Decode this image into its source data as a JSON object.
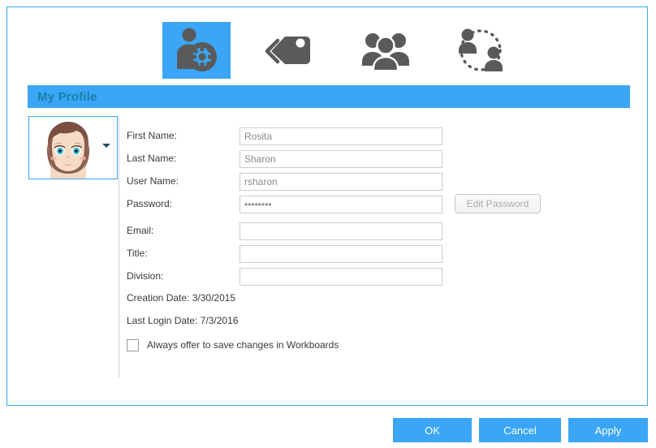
{
  "dialog": {
    "section_title": "My Profile",
    "accent_color": "#3aa6f5",
    "title_text_color": "#1a7fa9"
  },
  "toolbar": {
    "items": [
      {
        "name": "my-profile",
        "icon": "person-gear-icon",
        "selected": true
      },
      {
        "name": "tags",
        "icon": "tags-icon",
        "selected": false
      },
      {
        "name": "groups",
        "icon": "people-group-icon",
        "selected": false
      },
      {
        "name": "delegation",
        "icon": "people-sharing-icon",
        "selected": false
      }
    ]
  },
  "avatar": {
    "icon": "user-avatar-image",
    "dropdown_icon": "chevron-down-icon"
  },
  "form": {
    "fields": [
      {
        "label": "First Name:",
        "value": "Rosita",
        "placeholder": ""
      },
      {
        "label": "Last Name:",
        "value": "Sharon",
        "placeholder": ""
      },
      {
        "label": "User Name:",
        "value": "rsharon",
        "placeholder": ""
      },
      {
        "label": "Password:",
        "value": "••••••••",
        "placeholder": ""
      },
      {
        "label": "Email:",
        "value": "",
        "placeholder": ""
      },
      {
        "label": "Title:",
        "value": "",
        "placeholder": ""
      },
      {
        "label": "Division:",
        "value": "",
        "placeholder": ""
      }
    ],
    "edit_password_label": "Edit Password",
    "creation_date_line": "Creation Date: 3/30/2015",
    "last_login_line": "Last Login Date: 7/3/2016",
    "save_changes_label": "Always offer to save changes in Workboards",
    "save_changes_checked": false
  },
  "footer": {
    "ok_label": "OK",
    "cancel_label": "Cancel",
    "apply_label": "Apply"
  }
}
